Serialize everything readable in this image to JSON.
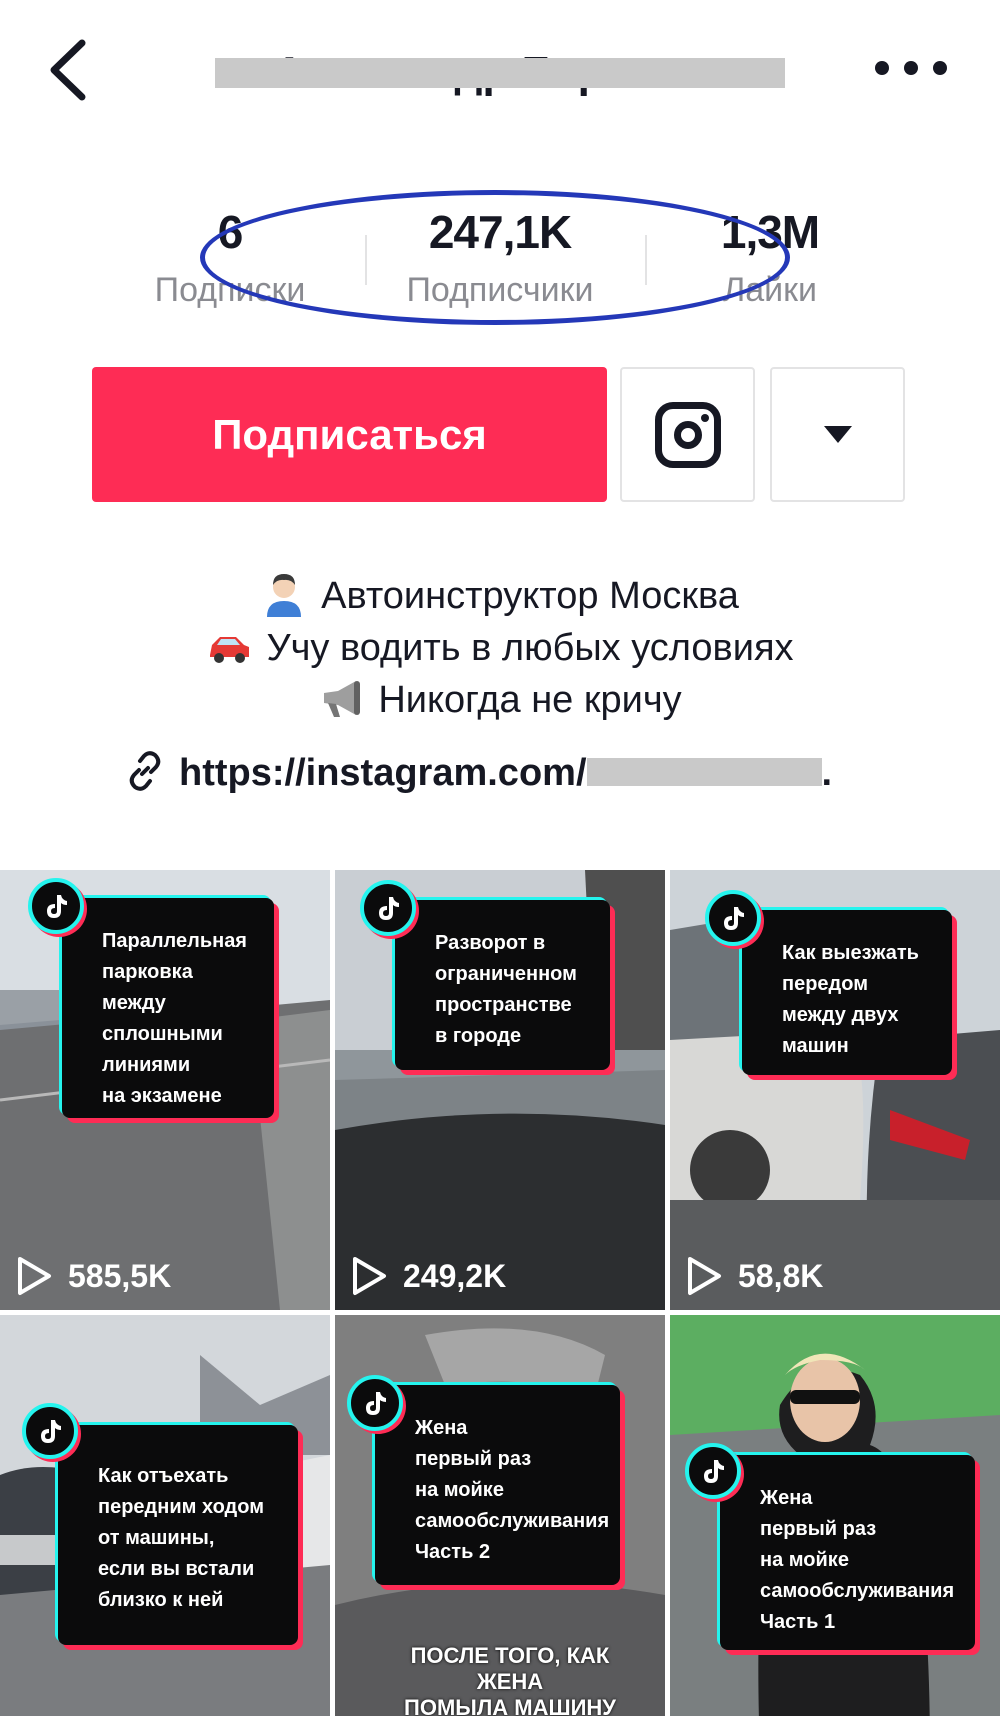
{
  "header": {
    "title": "Александр Березкин",
    "back_icon": "chevron-left-icon",
    "more_icon": "more-horizontal-icon"
  },
  "stats": [
    {
      "value": "6",
      "label": "Подписки"
    },
    {
      "value": "247,1K",
      "label": "Подписчики"
    },
    {
      "value": "1,3M",
      "label": "Лайки"
    }
  ],
  "actions": {
    "follow_label": "Подписаться",
    "instagram_icon": "instagram-icon",
    "dropdown_icon": "caret-down-icon"
  },
  "bio": {
    "lines": [
      {
        "icon": "person-emoji-icon",
        "text": "Автоинструктор Москва"
      },
      {
        "icon": "car-emoji-icon",
        "text": "Учу водить в любых условиях"
      },
      {
        "icon": "megaphone-emoji-icon",
        "text": "Никогда не кричу"
      }
    ],
    "link_prefix": "https://instagram.com/",
    "link_suffix": "."
  },
  "videos": [
    {
      "card_text": "Параллельная\nпарковка\nмежду\nсплошными\nлиниями\nна экзамене",
      "views": "585,5K"
    },
    {
      "card_text": "Разворот в\nограниченном\nпространстве\nв городе",
      "views": "249,2K"
    },
    {
      "card_text": "Как выезжать\nпередом\nмежду двух\nмашин",
      "views": "58,8K"
    },
    {
      "card_text": "Как отъехать\nпередним ходом\nот машины,\nесли вы встали\nблизко к ней",
      "views": ""
    },
    {
      "card_text": "Жена\nпервый раз\nна мойке\nсамообслуживания\nЧасть 2",
      "caption": "ПОСЛЕ ТОГО, КАК ЖЕНА\nПОМЫЛА МАШИНУ\nНА МОЙКЕ ВОДОЙ И ПЕНОЙ",
      "views": ""
    },
    {
      "card_text": "Жена\nпервый раз\nна мойке\nсамообслуживания\nЧасть 1",
      "views": ""
    }
  ],
  "colors": {
    "accent": "#fe2c55",
    "tiktok_cyan": "#25f4ee",
    "annotation_oval": "#2438b8"
  }
}
